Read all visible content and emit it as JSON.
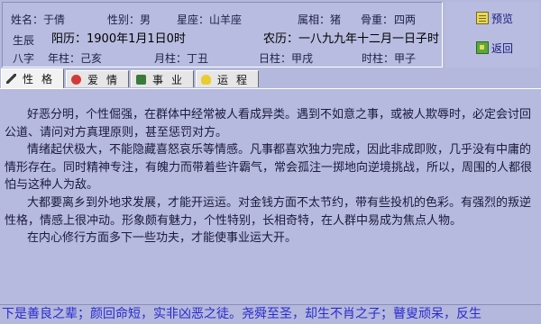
{
  "profile": {
    "name": "姓名：于倩",
    "gender": "性别：男",
    "zodiac": "星座：山羊座",
    "animal": "属相：猪",
    "bone_weight_label": "骨重：",
    "bone_weight_value": "四两",
    "birth_label": "生辰",
    "solar": "阳历：1900年1月1日0时",
    "lunar": "农历：一八九九年十二月一日子时",
    "bazi_label": "八字",
    "year_pillar": "年柱：己亥",
    "month_pillar": "月柱：丁丑",
    "day_pillar": "日柱：甲戌",
    "hour_pillar": "时柱：甲子"
  },
  "side_buttons": {
    "preview": "预览",
    "back": "返回"
  },
  "tabs": [
    {
      "label": "性格",
      "icon": "pen-icon"
    },
    {
      "label": "爱情",
      "icon": "heart-icon"
    },
    {
      "label": "事业",
      "icon": "briefcase-icon"
    },
    {
      "label": "运程",
      "icon": "lightbulb-icon"
    }
  ],
  "content": {
    "paragraphs": [
      "好恶分明，个性倔强，在群体中经常被人看成异类。遇到不如意之事，或被人欺辱时，必定会讨回公道、请问对方真理原则，甚至惩罚对方。",
      "情绪起伏极大，不能隐藏喜怒哀乐等情感。凡事都喜欢独力完成，因此非成即败，几乎没有中庸的情形存在。同时精神专注，有魄力而带着些许霸气，常会孤注一掷地向逆境挑战，所以，周围的人都很怕与这种人为敌。",
      "大都要离乡到外地求发展，才能开运运。对金钱方面不太节约，带有些投机的色彩。有强烈的叛逆性格，情感上很冲动。形象颇有魅力，个性特别，长相奇特，在人群中易成为焦点人物。",
      "在内心修行方面多下一些功夫，才能使事业运大开。"
    ]
  },
  "ticker": {
    "text": "下是善良之辈；颜回命短，实非凶恶之徒。尧舜至圣，却生不肖之子；瞽叟顽呆，反生"
  }
}
